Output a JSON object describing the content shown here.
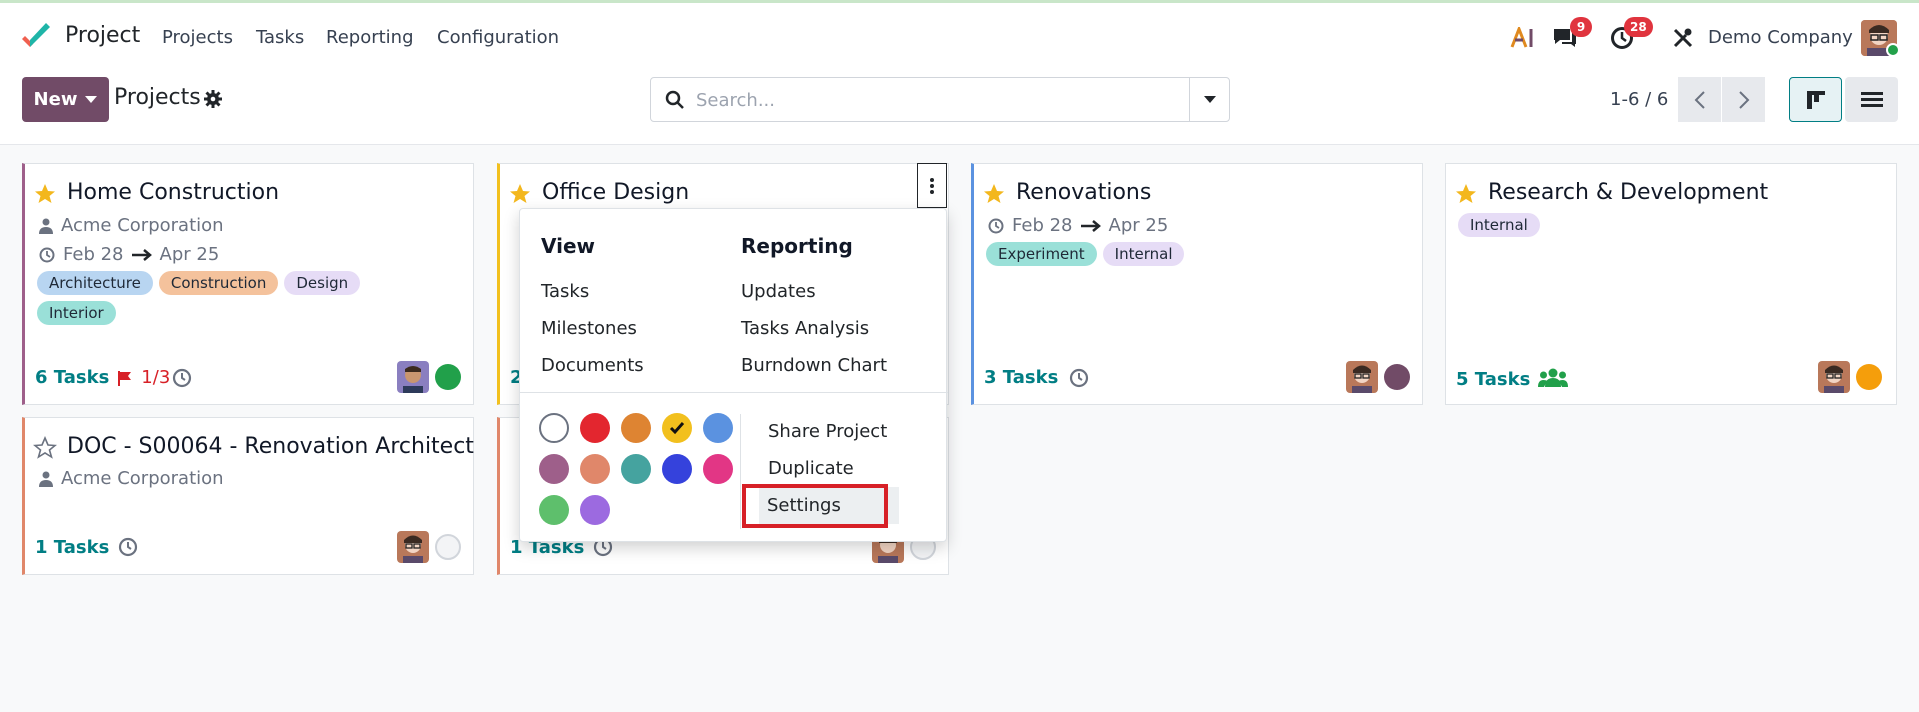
{
  "app": {
    "name": "Project"
  },
  "nav": {
    "items": [
      "Projects",
      "Tasks",
      "Reporting",
      "Configuration"
    ],
    "messages_badge": "9",
    "activities_badge": "28",
    "company": "Demo Company"
  },
  "control": {
    "new_label": "New",
    "breadcrumb": "Projects",
    "search_placeholder": "Search...",
    "pager": "1-6 / 6"
  },
  "colors": {
    "brand": "#714b67",
    "accent": "#017e84",
    "star": "#f3b71d"
  },
  "cards": [
    {
      "title": "Home Construction",
      "customer": "Acme Corporation",
      "date_start": "Feb 28",
      "date_end": "Apr 25",
      "tags": [
        "Architecture",
        "Construction",
        "Design",
        "Interior"
      ],
      "tasks": "6 Tasks",
      "milestones": "1/3",
      "status_color": "#21a04a",
      "favorite": true
    },
    {
      "title": "Office Design",
      "tasks": "2",
      "favorite": true
    },
    {
      "title": "Renovations",
      "date_start": "Feb 28",
      "date_end": "Apr 25",
      "tags": [
        "Experiment",
        "Internal"
      ],
      "tasks": "3 Tasks",
      "status_color": "#714b67",
      "favorite": true
    },
    {
      "title": "Research & Development",
      "tags": [
        "Internal"
      ],
      "tasks": "5 Tasks",
      "status_color": "#f59e0b",
      "favorite": true
    },
    {
      "title": "DOC - S00064 - Renovation Architect",
      "customer": "Acme Corporation",
      "tasks": "1 Tasks",
      "favorite": false
    },
    {
      "tasks": "1 Tasks",
      "favorite": false
    }
  ],
  "dropdown": {
    "view_heading": "View",
    "view_items": [
      "Tasks",
      "Milestones",
      "Documents"
    ],
    "reporting_heading": "Reporting",
    "reporting_items": [
      "Updates",
      "Tasks Analysis",
      "Burndown Chart"
    ],
    "actions": [
      "Share Project",
      "Duplicate",
      "Settings"
    ],
    "colors": [
      "#ffffff",
      "#e3262f",
      "#de8432",
      "#f2c01e",
      "#5b92e0",
      "#9e5f8a",
      "#e0876a",
      "#45a39f",
      "#3542dc",
      "#e23685",
      "#5ebf6c",
      "#9c6ae0"
    ],
    "selected_color_index": 3
  }
}
